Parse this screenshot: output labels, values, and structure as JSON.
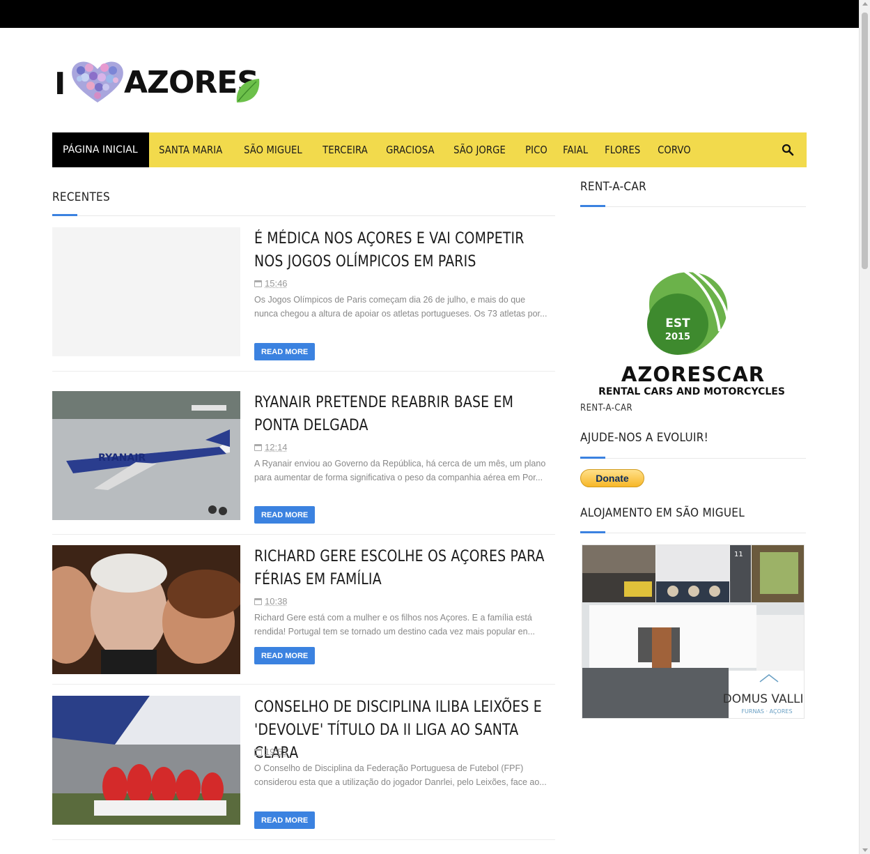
{
  "logo": {
    "prefix": "I",
    "word": "AZORES"
  },
  "nav": {
    "items": [
      "PÁGINA INICIAL",
      "SANTA MARIA",
      "SÃO MIGUEL",
      "TERCEIRA",
      "GRACIOSA",
      "SÃO JORGE",
      "PICO",
      "FAIAL",
      "FLORES",
      "CORVO"
    ],
    "active_index": 0
  },
  "main": {
    "section_title": "RECENTES",
    "articles": [
      {
        "title": "É MÉDICA NOS AÇORES E VAI COMPETIR NOS JOGOS OLÍMPICOS EM PARIS",
        "time": "15:46",
        "excerpt": "Os Jogos Olímpicos de Paris começam dia 26 de julho, e mais do que nunca chegou a altura de apoiar os atletas portugueses. Os 73 atletas por...",
        "button": "READ MORE"
      },
      {
        "title": "RYANAIR PRETENDE REABRIR BASE EM PONTA DELGADA",
        "time": "12:14",
        "excerpt": "A Ryanair enviou ao Governo da República, há cerca de um mês, um plano para aumentar de forma significativa o peso da companhia aérea em Por...",
        "button": "READ MORE",
        "image_text": "RYANAIR"
      },
      {
        "title": "RICHARD GERE ESCOLHE OS AÇORES PARA FÉRIAS EM FAMÍLIA",
        "time": "10:38",
        "excerpt": "Richard Gere está com a mulher e os filhos nos Açores. E a família está rendida! Portugal tem se tornado um destino cada vez mais popular en...",
        "button": "READ MORE"
      },
      {
        "title": "CONSELHO DE DISCIPLINA ILIBA LEIXÕES E 'DEVOLVE' TÍTULO DA II LIGA AO SANTA CLARA",
        "time": "19:53",
        "excerpt": "O Conselho de Disciplina da Federação Portuguesa de Futebol (FPF) considerou esta que a utilização do jogador Danrlei, pelo Leixões, face ao...",
        "button": "READ MORE"
      }
    ]
  },
  "sidebar": {
    "rentacar": {
      "title": "RENT-A-CAR",
      "ad_badge_top": "EST",
      "ad_badge_year": "2015",
      "ad_brand": "AZORESCAR",
      "ad_tagline": "RENTAL CARS AND MOTORCYCLES",
      "caption": "RENT-A-CAR"
    },
    "donate": {
      "title": "AJUDE-NOS A EVOLUIR!",
      "button": "Donate"
    },
    "alojamento": {
      "title": "ALOJAMENTO EM SÃO MIGUEL",
      "ad_number": "11",
      "ad_brand": "DOMUS VALLIS",
      "ad_sub": "FURNAS · AÇORES"
    }
  },
  "colors": {
    "nav_bg": "#f2da4c",
    "accent": "#3b82e0",
    "active_nav": "#000000"
  }
}
